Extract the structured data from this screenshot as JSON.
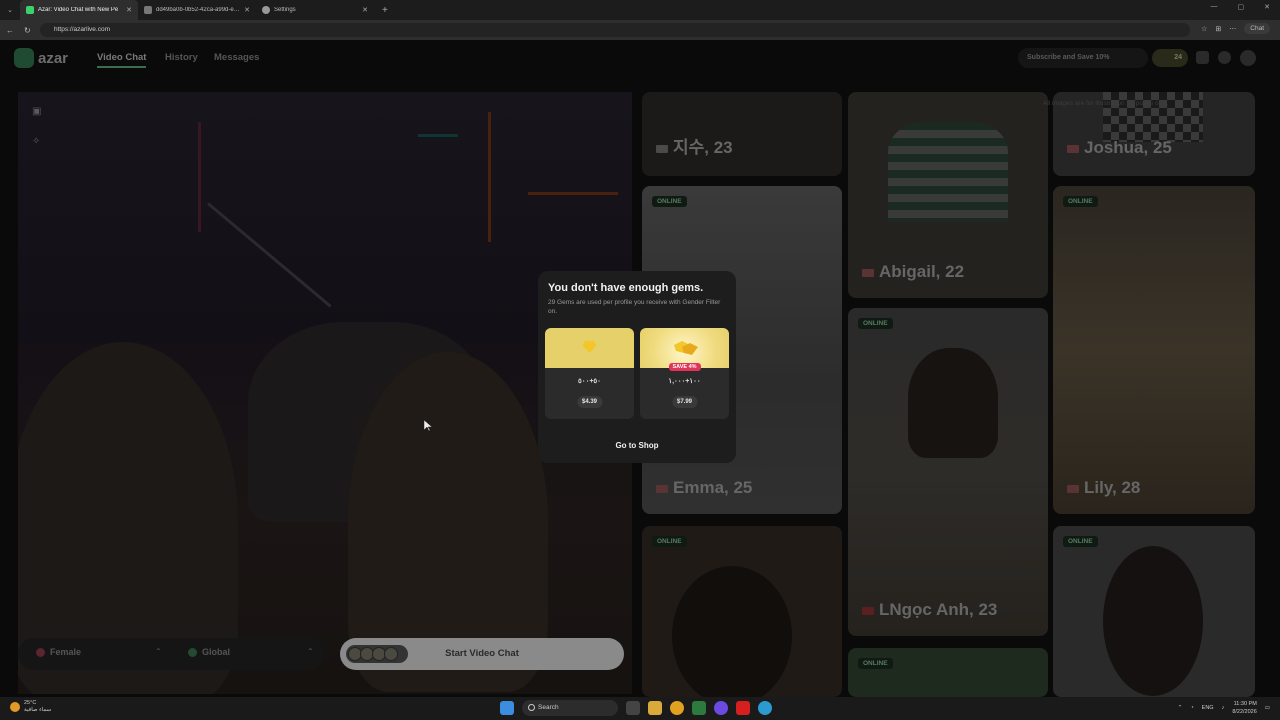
{
  "browser": {
    "tabs": [
      {
        "title": "Azar: Video Chat with New Pe",
        "active": true,
        "fav_color": "#3bd16f"
      },
      {
        "title": "dd49ba0b-0b52-42ca-a99d-eaacb",
        "active": false,
        "fav_color": "#777777"
      },
      {
        "title": "Settings",
        "active": false,
        "fav_color": "#999999"
      }
    ],
    "new_tab": "+",
    "url": "https://azarlive.com",
    "chat_button": "Chat"
  },
  "app": {
    "logo": "azar",
    "nav": {
      "video_chat": "Video Chat",
      "history": "History",
      "messages": "Messages"
    },
    "subscribe": "Subscribe and Save 10%",
    "gems": "24"
  },
  "video": {
    "filters": {
      "gender": "Female",
      "region": "Global"
    },
    "start_button": "Start Video Chat"
  },
  "grid": {
    "disclaimer": "All images are for illustration purposes only.",
    "online_label": "ONLINE",
    "profiles": [
      {
        "name": "지수, 23"
      },
      {
        "name": "Abigail, 22"
      },
      {
        "name": "Joshua, 25"
      },
      {
        "name": "Emma, 25"
      },
      {
        "name": "LNgọc Anh, 23"
      },
      {
        "name": "Lily, 28"
      }
    ]
  },
  "modal": {
    "title": "You don't have enough gems.",
    "subtitle": "29 Gems are used per profile you receive with Gender Filter on.",
    "packs": [
      {
        "amount": "٥٠+٥٠٠",
        "price": "$4.39",
        "badge": ""
      },
      {
        "amount": "١٠٠+١,٠٠٠",
        "price": "$7.99",
        "badge": "SAVE 4%"
      }
    ],
    "go_to_shop": "Go to Shop"
  },
  "taskbar": {
    "weather_temp": "25°C",
    "weather_desc": "سماء صافية",
    "search": "Search",
    "lang": "ENG",
    "time": "11:30 PM",
    "date": "8/22/2026"
  }
}
